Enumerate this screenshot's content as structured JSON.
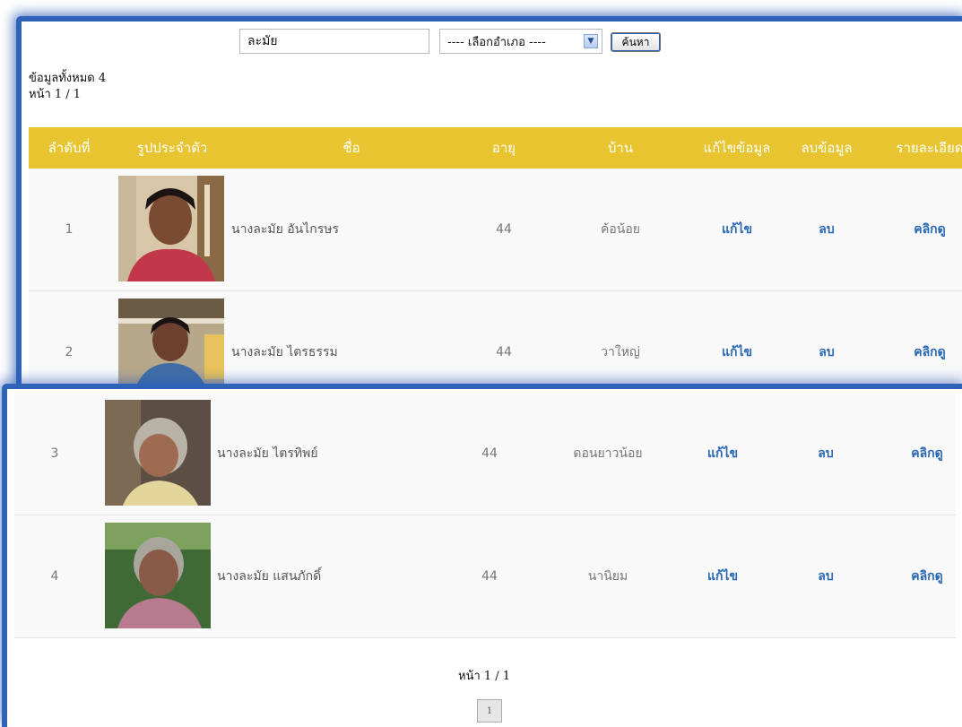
{
  "search": {
    "query": "ละมัย",
    "district_selected": "---- เลือกอำเภอ ----",
    "button_label": "ค้นหา"
  },
  "summary": {
    "total": "ข้อมูลทั้งหมด 4",
    "page": "หน้า 1 / 1"
  },
  "table": {
    "headers": [
      "ลำดับที่",
      "รูปประจำตัว",
      "ชื่อ",
      "อายุ",
      "บ้าน",
      "แก้ไขข้อมูล",
      "ลบข้อมูล",
      "รายละเอียด"
    ],
    "rows": [
      {
        "no": "1",
        "name": "นางละมัย อันไกรษร",
        "age": "44",
        "village": "ค้อน้อย",
        "edit": "แก้ไข",
        "delete": "ลบ",
        "detail": "คลิกดู"
      },
      {
        "no": "2",
        "name": "นางละมัย ไตรธรรม",
        "age": "44",
        "village": "วาใหญ่",
        "edit": "แก้ไข",
        "delete": "ลบ",
        "detail": "คลิกดู"
      },
      {
        "no": "3",
        "name": "นางละมัย ไตรทิพย์",
        "age": "44",
        "village": "ดอนยาวน้อย",
        "edit": "แก้ไข",
        "delete": "ลบ",
        "detail": "คลิกดู"
      },
      {
        "no": "4",
        "name": "นางละมัย แสนภักดิ์",
        "age": "44",
        "village": "นานิยม",
        "edit": "แก้ไข",
        "delete": "ลบ",
        "detail": "คลิกดู"
      }
    ]
  },
  "pagination": {
    "label": "หน้า 1 / 1",
    "current": "1"
  },
  "colors": {
    "header_bg": "#e8c530",
    "link": "#2a68b5",
    "frame": "#2f63b8"
  }
}
